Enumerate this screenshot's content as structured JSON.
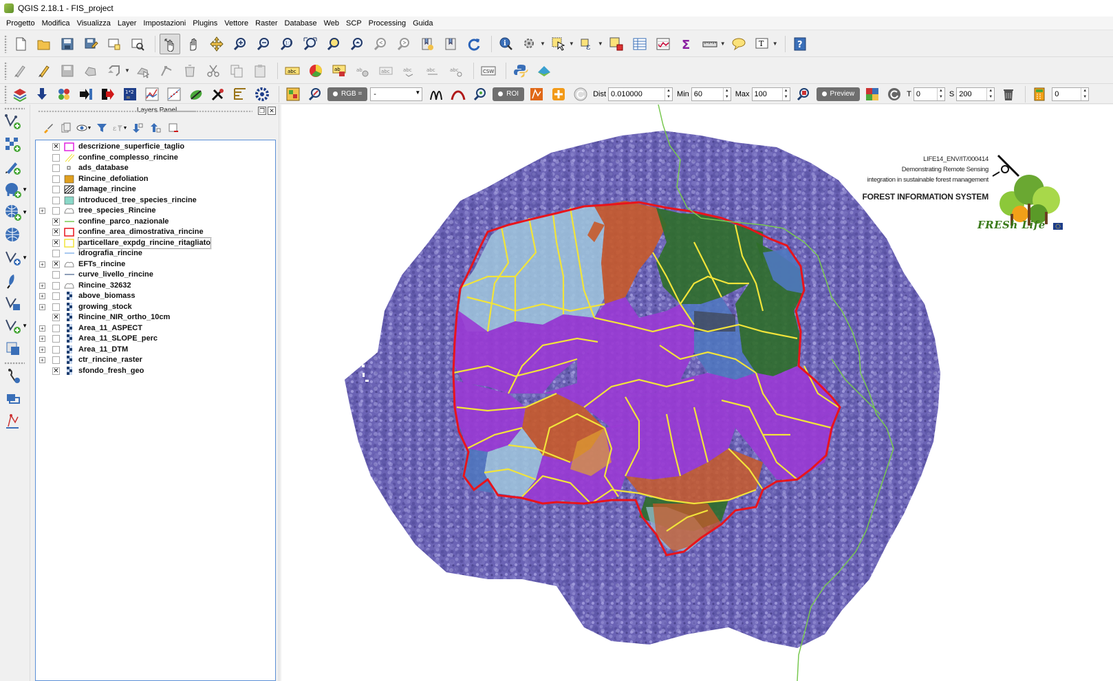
{
  "window": {
    "title": "QGIS 2.18.1 - FIS_project"
  },
  "menubar": {
    "items": [
      "Progetto",
      "Modifica",
      "Visualizza",
      "Layer",
      "Impostazioni",
      "Plugins",
      "Vettore",
      "Raster",
      "Database",
      "Web",
      "SCP",
      "Processing",
      "Guida"
    ]
  },
  "toolbar1": {
    "icons": [
      "new-project-icon",
      "open-project-icon",
      "save-project-icon",
      "save-as-icon",
      "new-print-composer-icon",
      "composer-manager-icon",
      "touch-zoom-icon",
      "pan-map-icon",
      "pan-to-selection-icon",
      "zoom-in-icon",
      "zoom-out-icon",
      "zoom-native-icon",
      "zoom-full-icon",
      "zoom-to-selection-icon",
      "zoom-to-layer-icon",
      "zoom-last-icon",
      "zoom-next-icon",
      "new-bookmark-icon",
      "show-bookmarks-icon",
      "refresh-icon",
      "identify-icon",
      "run-action-icon",
      "select-feature-icon",
      "select-by-expression-icon",
      "deselect-icon",
      "open-attribute-table-icon",
      "field-calculator-icon",
      "statistical-summary-icon",
      "measure-line-icon",
      "map-tips-icon",
      "text-annotation-icon",
      "help-icon"
    ]
  },
  "toolbar2": {
    "icons": [
      "current-edits-icon",
      "toggle-editing-icon",
      "save-edits-icon",
      "add-feature-icon",
      "move-feature-icon",
      "node-tool-icon",
      "delete-selected-icon",
      "cut-features-icon",
      "copy-features-icon",
      "paste-features-icon",
      "label-toolbar-icon",
      "diagram-icon",
      "pin-labels-icon",
      "show-labels-icon",
      "move-label-icon",
      "rotate-label-icon",
      "change-label-icon",
      "label-properties-icon",
      "csw-icon",
      "python-console-icon",
      "plugin-icon"
    ],
    "csw_label": "CSW"
  },
  "toolbar3": {
    "rgb_label": "RGB =",
    "rgb_value": "-",
    "roi_label": "ROI",
    "dist_label": "Dist",
    "dist_value": "0.010000",
    "min_label": "Min",
    "min_value": "60",
    "max_label": "Max",
    "max_value": "100",
    "preview_label": "Preview",
    "t_label": "T",
    "t_value": "0",
    "s_label": "S",
    "s_value": "200",
    "last_value": "0"
  },
  "layers_panel": {
    "title": "Layers Panel",
    "float_btn": "❐",
    "close_btn": "✕",
    "layers": [
      {
        "name": "descrizione_superficie_taglio",
        "checked": true,
        "expand": false,
        "symbol": "poly-magenta"
      },
      {
        "name": "confine_complesso_rincine",
        "checked": false,
        "expand": false,
        "symbol": "poly-hatch-yellow"
      },
      {
        "name": "ads_database",
        "checked": false,
        "expand": false,
        "symbol": "point"
      },
      {
        "name": "Rincine_defoliation",
        "checked": false,
        "expand": false,
        "symbol": "poly-orange"
      },
      {
        "name": "damage_rincine",
        "checked": false,
        "expand": false,
        "symbol": "poly-hatch-black"
      },
      {
        "name": "introduced_tree_species_rincine",
        "checked": false,
        "expand": false,
        "symbol": "poly-teal"
      },
      {
        "name": "tree_species_Rincine",
        "checked": false,
        "expand": true,
        "symbol": "group"
      },
      {
        "name": "confine_parco_nazionale",
        "checked": true,
        "expand": false,
        "symbol": "line-green"
      },
      {
        "name": "confine_area_dimostrativa_rincine",
        "checked": true,
        "expand": false,
        "symbol": "poly-red"
      },
      {
        "name": "particellare_expdg_rincine_ritagliato",
        "checked": true,
        "expand": false,
        "symbol": "poly-yellow",
        "selected": true
      },
      {
        "name": "idrografia_rincine",
        "checked": false,
        "expand": false,
        "symbol": "line-lightblue"
      },
      {
        "name": "EFTs_rincine",
        "checked": true,
        "expand": true,
        "symbol": "group"
      },
      {
        "name": "curve_livello_rincine",
        "checked": false,
        "expand": false,
        "symbol": "line-navy"
      },
      {
        "name": "Rincine_32632",
        "checked": false,
        "expand": true,
        "symbol": "group"
      },
      {
        "name": "above_biomass",
        "checked": false,
        "expand": true,
        "symbol": "raster"
      },
      {
        "name": "growing_stock",
        "checked": false,
        "expand": true,
        "symbol": "raster"
      },
      {
        "name": "Rincine_NIR_ortho_10cm",
        "checked": true,
        "expand": false,
        "symbol": "raster"
      },
      {
        "name": "Area_11_ASPECT",
        "checked": false,
        "expand": true,
        "symbol": "raster"
      },
      {
        "name": "Area_11_SLOPE_perc",
        "checked": false,
        "expand": true,
        "symbol": "raster"
      },
      {
        "name": "Area_11_DTM",
        "checked": false,
        "expand": true,
        "symbol": "raster"
      },
      {
        "name": "ctr_rincine_raster",
        "checked": false,
        "expand": true,
        "symbol": "raster"
      },
      {
        "name": "sfondo_fresh_geo",
        "checked": true,
        "expand": false,
        "symbol": "raster"
      }
    ]
  },
  "map": {
    "logo_line1": "LIFE14_ENV/IT/000414",
    "logo_line2": "Demonstrating Remote Sensing",
    "logo_line3": "integration in sustainable forest management",
    "logo_title": "FOREST INFORMATION SYSTEM",
    "logo_brand": "FRESh Life",
    "colors": {
      "background_raster": "#7068b8",
      "boundary_red": "#e8141c",
      "parcels_yellow": "#f2e43a",
      "eft_purple": "#9a3ad4",
      "eft_orange": "#c85a2a",
      "eft_green": "#2f6e2a",
      "eft_lightblue": "#9ec4dc",
      "eft_blue": "#4f78c0",
      "park_boundary_green": "#78c850"
    }
  }
}
